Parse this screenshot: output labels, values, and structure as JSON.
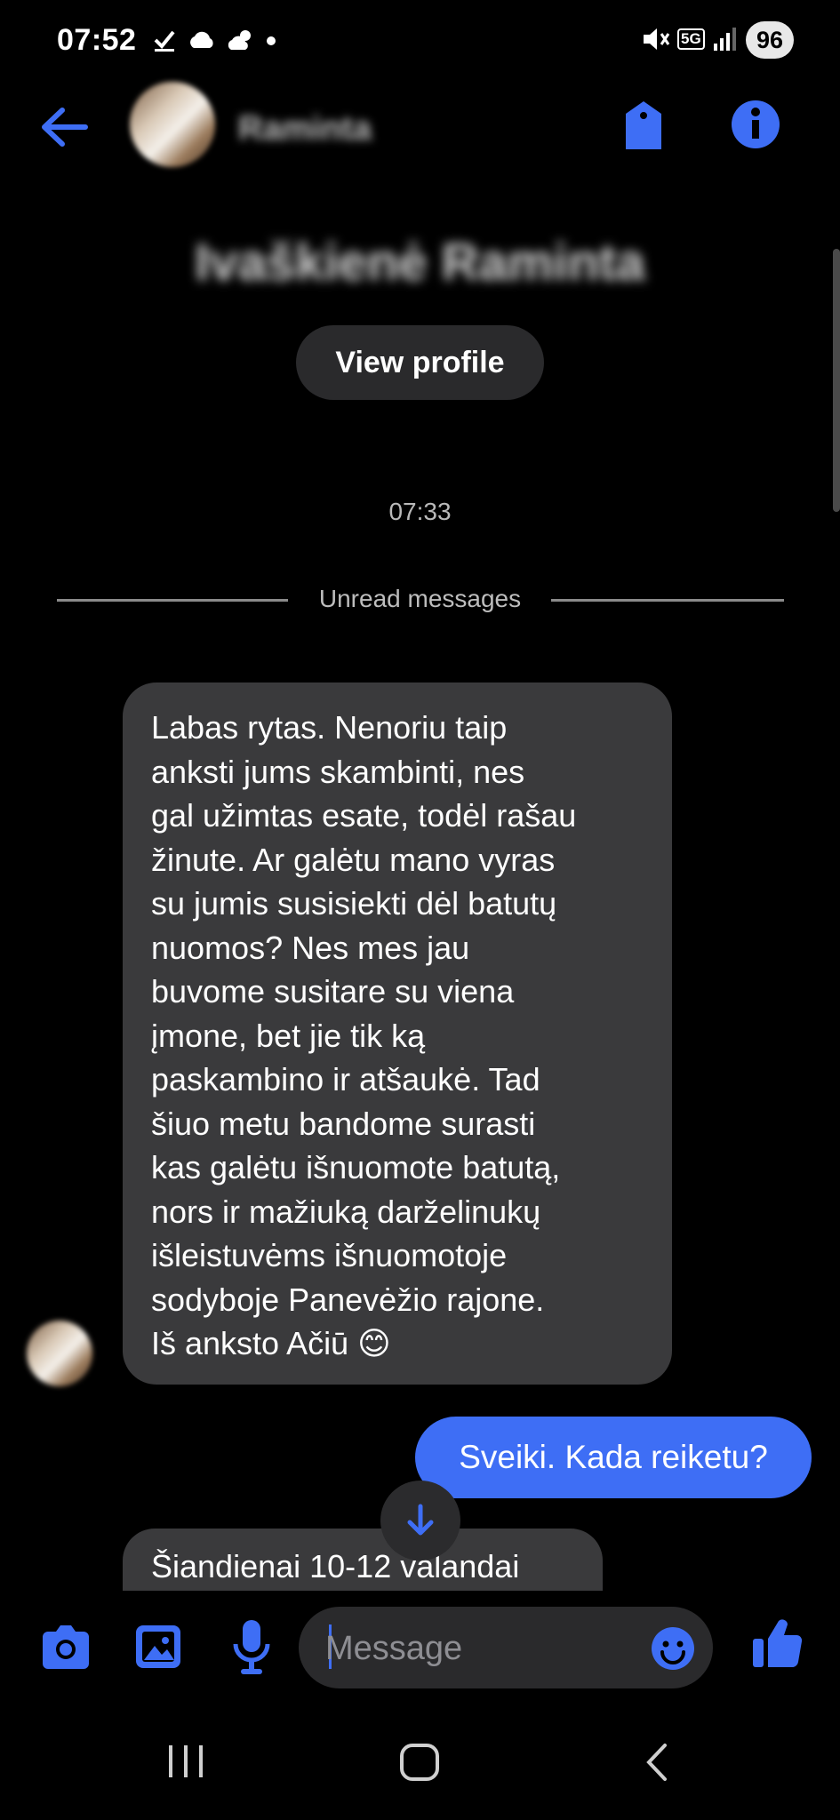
{
  "status_bar": {
    "time": "07:52",
    "battery": "96",
    "network": "5G",
    "icons": [
      "check-icon",
      "cloud-icon",
      "weather-icon",
      "dot-icon",
      "mute-icon",
      "signal-icon"
    ]
  },
  "header": {
    "back_icon": "back-arrow-icon",
    "name_blurred": "Raminta",
    "actions": [
      "tag-icon",
      "info-icon"
    ]
  },
  "profile": {
    "name": "Ivaškienė Raminta",
    "view_profile_label": "View profile"
  },
  "conversation": {
    "timestamp": "07:33",
    "unread_label": "Unread messages",
    "messages": [
      {
        "direction": "incoming",
        "lines": [
          "Labas rytas. Nenoriu taip",
          "anksti jums skambinti, nes",
          "gal užimtas esate, todėl rašau",
          "žinute. Ar galėtu mano vyras",
          "su jumis susisiekti dėl batutų",
          "nuomos? Nes mes jau",
          "buvome susitare su viena",
          "įmone, bet jie tik ką",
          "paskambino ir atšaukė. Tad",
          "šiuo metu bandome surasti",
          "kas galėtu išnuomote batutą,",
          "nors ir mažiuką darželinukų",
          "išleistuvėms išnuomotoje",
          "sodyboje Panevėžio rajone.",
          "Iš anksto Ačiū 😊"
        ]
      },
      {
        "direction": "outgoing",
        "text": "Sveiki. Kada reiketu?"
      },
      {
        "direction": "incoming",
        "text": "Šiandienai 10-12 valandai"
      }
    ]
  },
  "composer": {
    "placeholder": "Message",
    "icons": [
      "camera-icon",
      "gallery-icon",
      "microphone-icon",
      "emoji-icon",
      "thumbs-up-icon"
    ]
  },
  "colors": {
    "accent": "#3e6ef5",
    "bubble_incoming": "#3a3a3c",
    "background": "#000000"
  }
}
